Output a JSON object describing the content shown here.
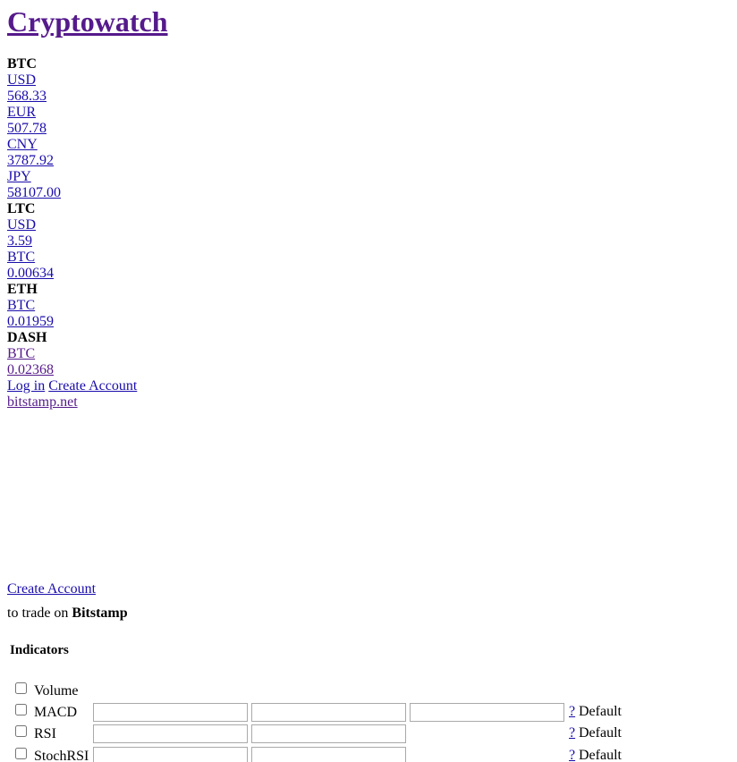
{
  "site": {
    "title": "Cryptowatch"
  },
  "markets": [
    {
      "asset": "BTC",
      "quotes": [
        {
          "currency": "USD",
          "price": "568.33"
        },
        {
          "currency": "EUR",
          "price": "507.78"
        },
        {
          "currency": "CNY",
          "price": "3787.92"
        },
        {
          "currency": "JPY",
          "price": "58107.00"
        }
      ]
    },
    {
      "asset": "LTC",
      "quotes": [
        {
          "currency": "USD",
          "price": "3.59"
        },
        {
          "currency": "BTC",
          "price": "0.00634"
        }
      ]
    },
    {
      "asset": "ETH",
      "quotes": [
        {
          "currency": "BTC",
          "price": "0.01959"
        }
      ]
    },
    {
      "asset": "DASH",
      "quotes": [
        {
          "currency": "BTC",
          "price": "0.02368"
        }
      ]
    }
  ],
  "auth": {
    "login_label": "Log in",
    "create_account_label": "Create Account"
  },
  "exchange": {
    "link_label": "bitstamp.net"
  },
  "trade": {
    "create_account_label": "Create Account",
    "text_prefix": "to trade on",
    "exchange_name": "Bitstamp"
  },
  "indicators": {
    "title": "Indicators",
    "help_label": "?",
    "default_label": "Default",
    "items": [
      {
        "name": "Volume",
        "params": 0
      },
      {
        "name": "MACD",
        "params": 3
      },
      {
        "name": "RSI",
        "params": 2
      },
      {
        "name": "StochRSI",
        "params": 2
      }
    ]
  }
}
